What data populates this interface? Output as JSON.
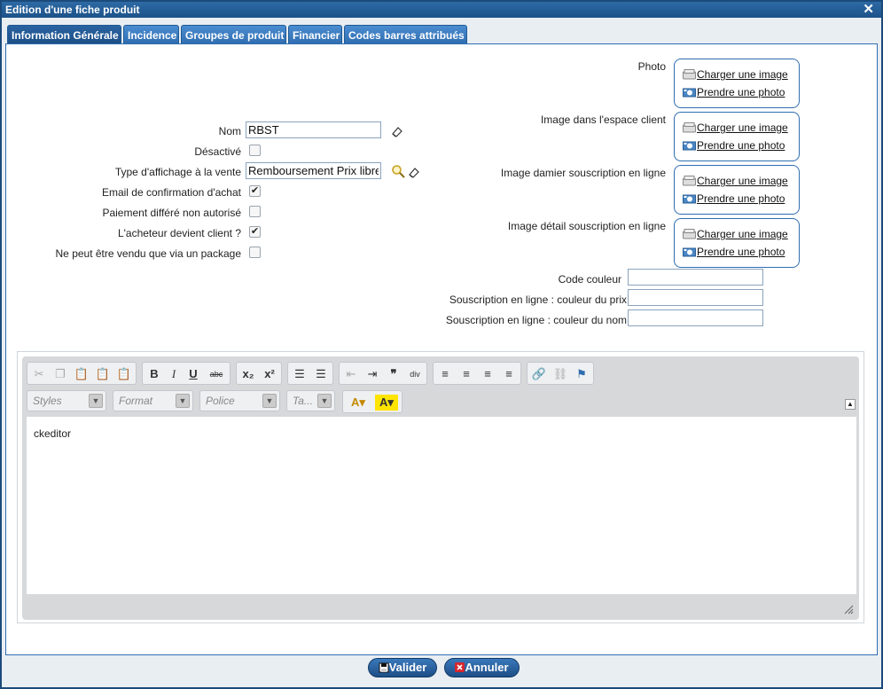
{
  "window": {
    "title": "Edition d'une fiche produit",
    "close": "✕"
  },
  "tabs": [
    {
      "label": "Information Générale",
      "active": true
    },
    {
      "label": "Incidence"
    },
    {
      "label": "Groupes de produit"
    },
    {
      "label": "Financier"
    },
    {
      "label": "Codes barres attribués"
    }
  ],
  "form": {
    "nom_label": "Nom",
    "nom_value": "RBST",
    "desactive_label": "Désactivé",
    "desactive_checked": false,
    "type_label": "Type d'affichage à la vente",
    "type_value": "Remboursement Prix libre",
    "email_label": "Email de confirmation d'achat",
    "email_checked": true,
    "paiement_label": "Paiement différé non autorisé",
    "paiement_checked": false,
    "acheteur_label": "L'acheteur devient client ?",
    "acheteur_checked": true,
    "package_label": "Ne peut être vendu que via un package",
    "package_checked": false,
    "check_mark": "✔"
  },
  "images": {
    "load_label": "Charger une image",
    "photo_label": "Prendre une photo",
    "items": [
      {
        "label": "Photo"
      },
      {
        "label": "Image dans l'espace client"
      },
      {
        "label": "Image damier souscription en ligne"
      },
      {
        "label": "Image détail souscription en ligne"
      }
    ]
  },
  "colors": {
    "code_couleur_label": "Code couleur",
    "prix_label": "Souscription en ligne : couleur du prix",
    "nom_label": "Souscription en ligne : couleur du nom"
  },
  "editor": {
    "styles": "Styles",
    "format": "Format",
    "police": "Police",
    "taille": "Ta...",
    "content": "ckeditor"
  },
  "buttons": {
    "valider": "Valider",
    "annuler": "Annuler"
  }
}
